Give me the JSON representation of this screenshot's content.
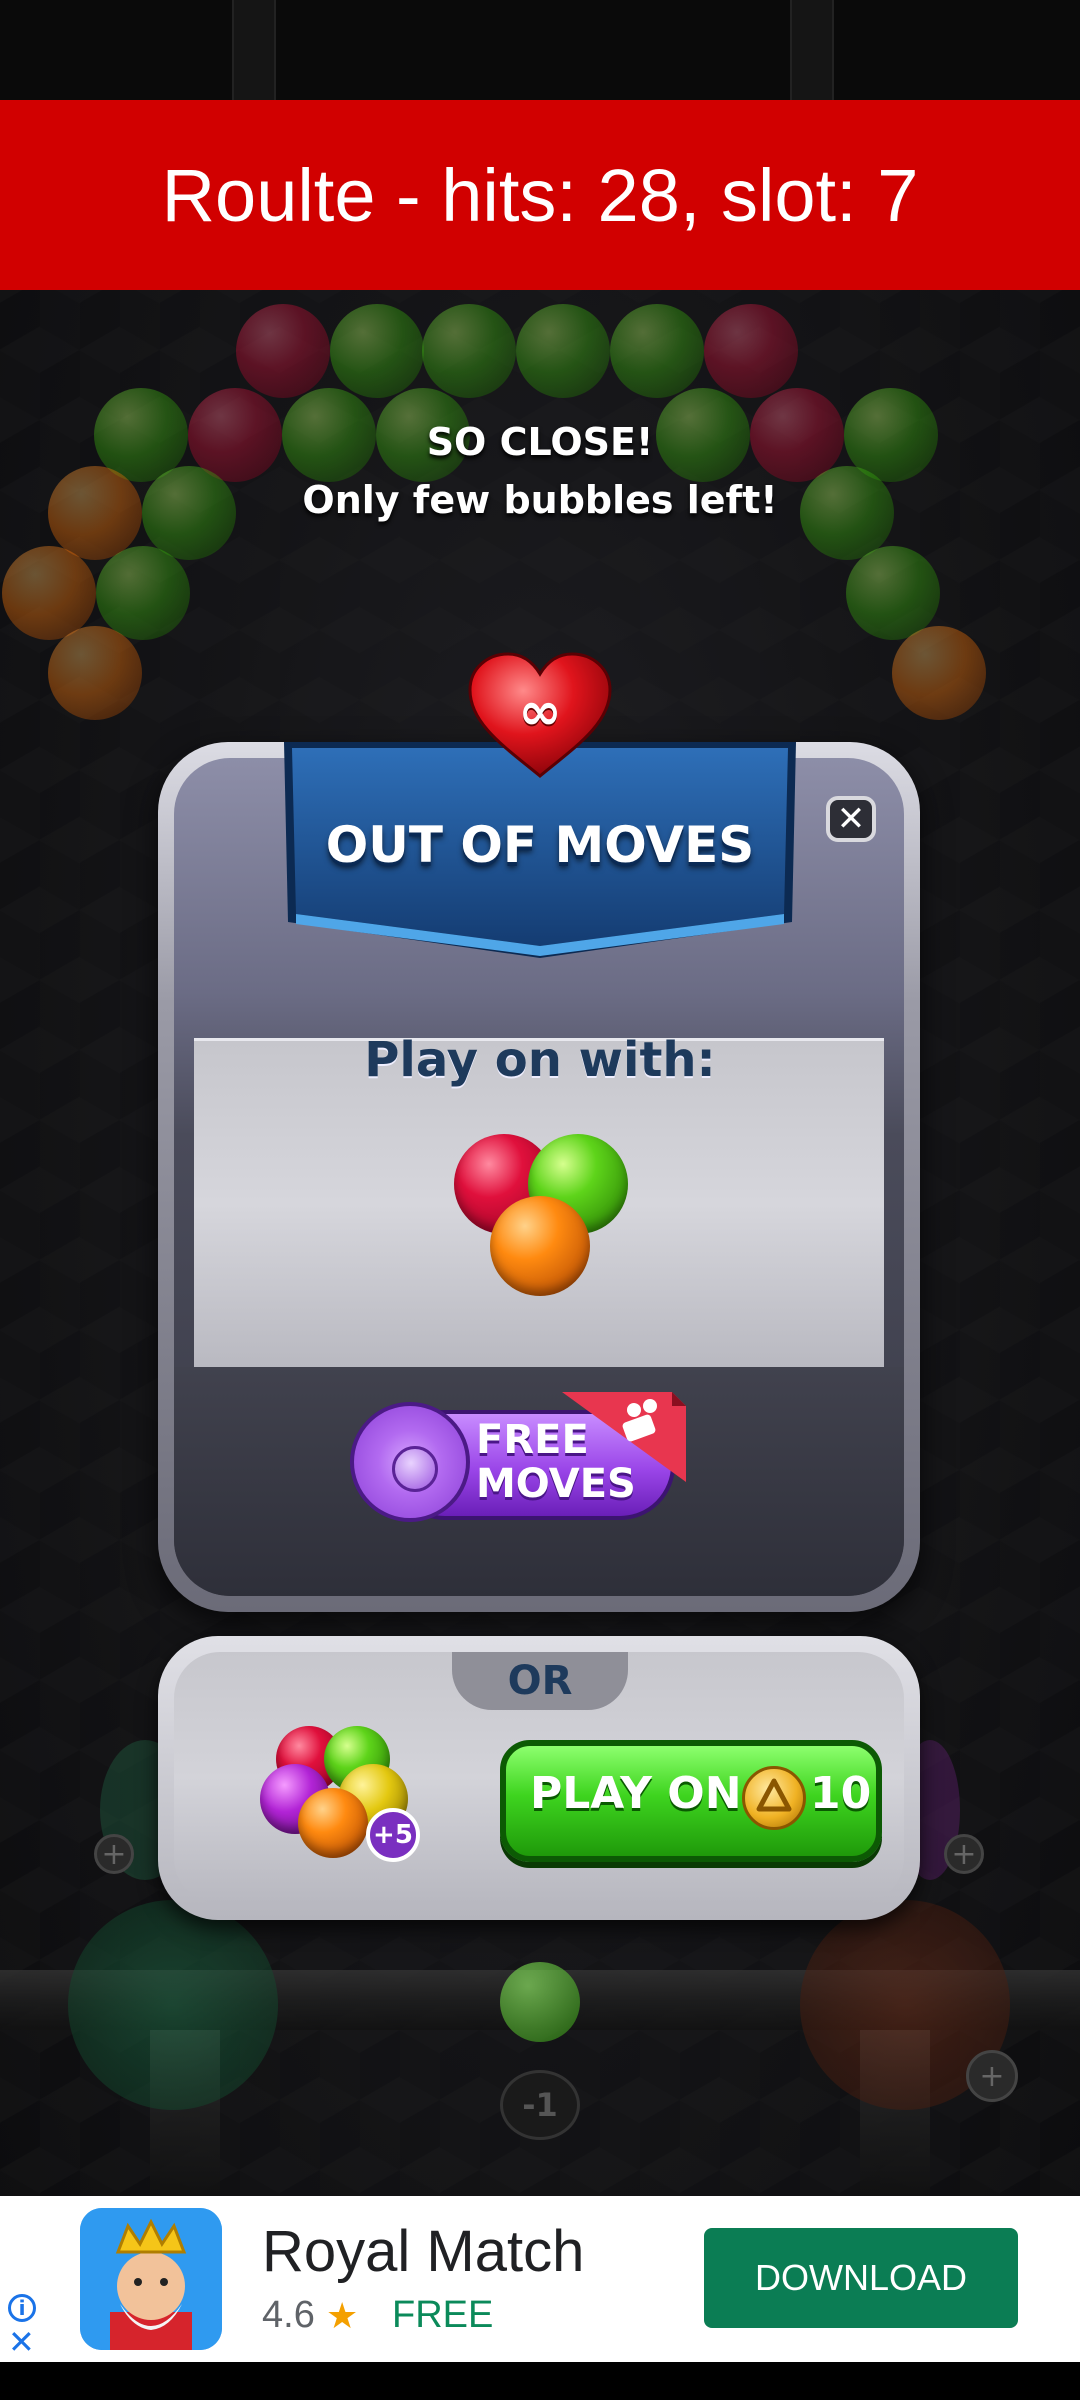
{
  "banner": {
    "text": "Roulte - hits: 28, slot: 7"
  },
  "hint": {
    "line1": "SO CLOSE!",
    "line2": "Only few bubbles left!"
  },
  "modal": {
    "title": "OUT OF MOVES",
    "close_label": "✕",
    "heart_symbol": "∞",
    "play_on_with": "Play on with:",
    "free_moves": {
      "line1": "FREE",
      "line2": "MOVES"
    },
    "or_label": "OR",
    "bonus_badge": "+5",
    "play_on_button": {
      "label": "PLAY ON",
      "cost": "10",
      "currency_icon": "coin-icon"
    }
  },
  "bottom_area": {
    "counter": "-1"
  },
  "ad": {
    "title": "Royal Match",
    "rating": "4.6",
    "price": "FREE",
    "cta": "DOWNLOAD",
    "info_icon": "i",
    "close_icon": "✕"
  },
  "colors": {
    "banner_red": "#d10000",
    "ribbon_blue": "#1b4f8f",
    "free_purple": "#9a45e8",
    "play_green": "#3ed41f",
    "ad_green": "#0b7d54"
  }
}
